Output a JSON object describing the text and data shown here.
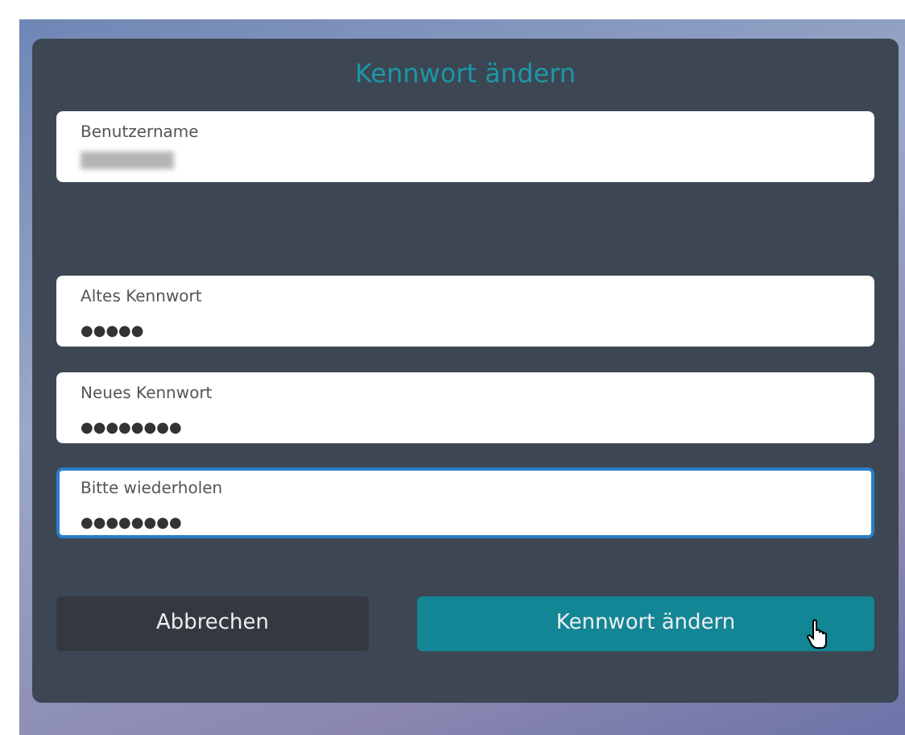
{
  "dialog": {
    "title": "Kennwort ändern"
  },
  "fields": [
    {
      "label": "Benutzername",
      "kind": "blurred",
      "focused": false
    },
    {
      "label": "Altes Kennwort",
      "kind": "text",
      "value": "●●●●●",
      "focused": false
    },
    {
      "label": "Neues Kennwort",
      "kind": "text",
      "value": "●●●●●●●●",
      "focused": false
    },
    {
      "label": "Bitte wiederholen",
      "kind": "text",
      "value": "●●●●●●●●",
      "focused": true
    }
  ],
  "buttons": [
    {
      "label": "Abbrechen",
      "kind": "secondary"
    },
    {
      "label": "Kennwort ändern",
      "kind": "primary",
      "hovered": true
    }
  ]
}
